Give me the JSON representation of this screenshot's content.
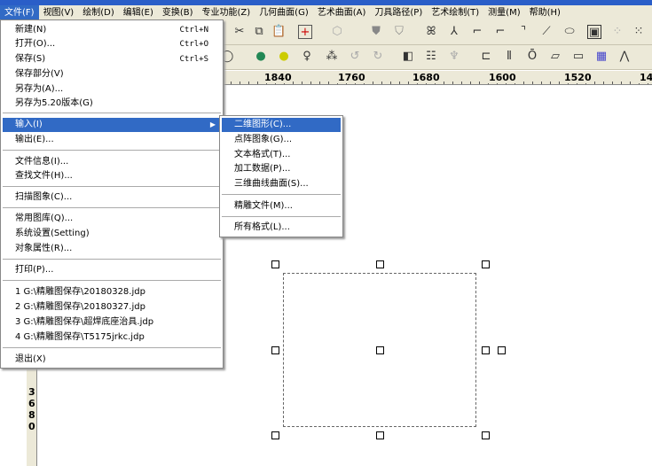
{
  "menubar": [
    "文件(F)",
    "视图(V)",
    "绘制(D)",
    "编辑(E)",
    "变换(B)",
    "专业功能(Z)",
    "几何曲面(G)",
    "艺术曲面(A)",
    "刀具路径(P)",
    "艺术绘制(T)",
    "测量(M)",
    "帮助(H)"
  ],
  "file_menu": [
    {
      "label": "新建(N)",
      "shortcut": "Ctrl+N"
    },
    {
      "label": "打开(O)...",
      "shortcut": "Ctrl+O"
    },
    {
      "label": "保存(S)",
      "shortcut": "Ctrl+S"
    },
    {
      "label": "保存部分(V)"
    },
    {
      "label": "另存为(A)..."
    },
    {
      "label": "另存为5.20版本(G)"
    },
    {
      "label": "输入(I)"
    },
    {
      "label": "输出(E)..."
    },
    {
      "label": "文件信息(I)..."
    },
    {
      "label": "查找文件(H)..."
    },
    {
      "label": "扫描图象(C)..."
    },
    {
      "label": "常用图库(Q)..."
    },
    {
      "label": "系统设置(Setting)"
    },
    {
      "label": "对象属性(R)..."
    },
    {
      "label": "打印(P)..."
    },
    {
      "label": "1 G:\\精雕图保存\\20180328.jdp"
    },
    {
      "label": "2 G:\\精雕图保存\\20180327.jdp"
    },
    {
      "label": "3 G:\\精雕图保存\\超焊底座治具.jdp"
    },
    {
      "label": "4 G:\\精雕图保存\\T5175jrkc.jdp"
    },
    {
      "label": "退出(X)"
    }
  ],
  "submenu": [
    "二维图形(C)...",
    "点阵图象(G)...",
    "文本格式(T)...",
    "加工数据(P)...",
    "三维曲线曲面(S)...",
    "精雕文件(M)...",
    "所有格式(L)..."
  ],
  "ruler": [
    "1840",
    "1760",
    "1680",
    "1600",
    "1520",
    "14"
  ],
  "vruler": [
    "3",
    "6",
    "8",
    "0"
  ],
  "colors": {
    "highlight": "#316ac5",
    "chrome": "#ece9d8"
  }
}
